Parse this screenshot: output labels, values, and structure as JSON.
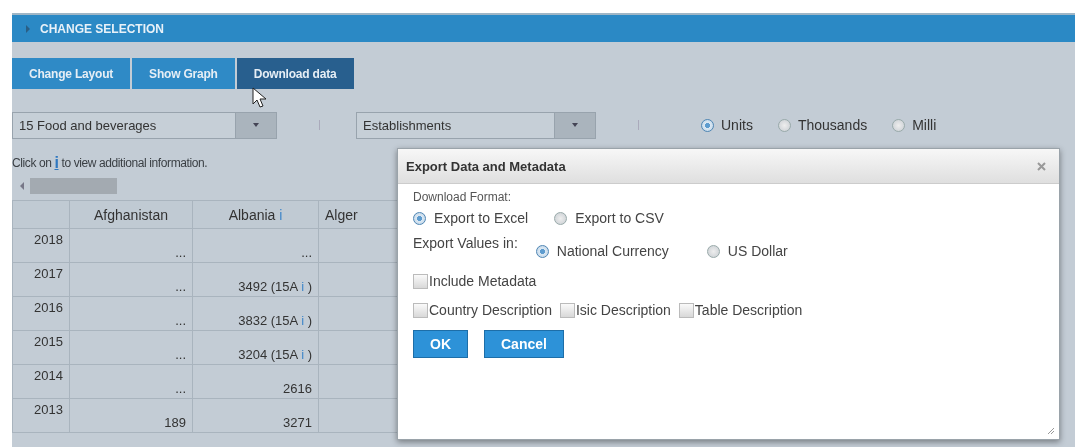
{
  "header": {
    "title": "CHANGE SELECTION"
  },
  "toolbar": [
    {
      "label": "Change Layout",
      "selected": false
    },
    {
      "label": "Show Graph",
      "selected": false
    },
    {
      "label": "Download data",
      "selected": true
    }
  ],
  "filters": [
    {
      "value": "15 Food and beverages"
    },
    {
      "value": "Establishments"
    }
  ],
  "units": [
    {
      "label": "Units",
      "selected": true
    },
    {
      "label": "Thousands",
      "selected": false
    },
    {
      "label": "Milli",
      "selected": false
    }
  ],
  "info_line": {
    "before": "Click on",
    "mark": "i",
    "after": "to view additional information."
  },
  "table": {
    "columns": [
      {
        "label": "Afghanistan"
      },
      {
        "label": "Albania",
        "info": "i"
      },
      {
        "label": "Alger"
      }
    ],
    "rows": [
      {
        "year": "2018",
        "cells": [
          {
            "value": "..."
          },
          {
            "value": "..."
          }
        ]
      },
      {
        "year": "2017",
        "cells": [
          {
            "value": "..."
          },
          {
            "value": "3492 (15A",
            "info": "i",
            "suffix": ")"
          }
        ]
      },
      {
        "year": "2016",
        "cells": [
          {
            "value": "..."
          },
          {
            "value": "3832 (15A",
            "info": "i",
            "suffix": ")"
          }
        ]
      },
      {
        "year": "2015",
        "cells": [
          {
            "value": "..."
          },
          {
            "value": "3204 (15A",
            "info": "i",
            "suffix": ")"
          }
        ]
      },
      {
        "year": "2014",
        "cells": [
          {
            "value": "..."
          },
          {
            "value": "2616"
          }
        ]
      },
      {
        "year": "2013",
        "cells": [
          {
            "value": "189"
          },
          {
            "value": "3271"
          }
        ]
      }
    ]
  },
  "dialog": {
    "title": "Export Data and Metadata",
    "format_label": "Download Format:",
    "format_options": [
      {
        "label": "Export to Excel",
        "selected": true
      },
      {
        "label": "Export to CSV",
        "selected": false
      }
    ],
    "values_label": "Export Values in:",
    "currency_options": [
      {
        "label": "National Currency",
        "selected": true
      },
      {
        "label": "US Dollar",
        "selected": false
      }
    ],
    "checkbox_rows": [
      {
        "items": [
          {
            "label": "Include Metadata",
            "checked": false
          }
        ]
      },
      {
        "items": [
          {
            "label": "Country Description",
            "checked": false
          },
          {
            "label": "Isic Description",
            "checked": false
          },
          {
            "label": "Table Description",
            "checked": false
          }
        ]
      }
    ],
    "buttons": [
      "OK",
      "Cancel"
    ]
  }
}
